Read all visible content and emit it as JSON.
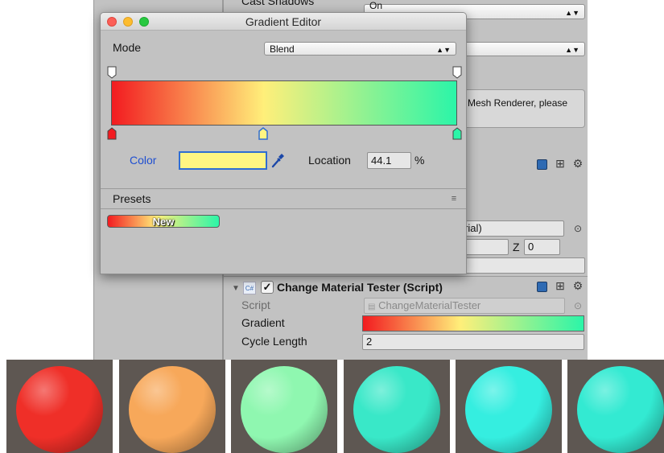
{
  "inspector": {
    "cast_shadows_label": "Cast Shadows",
    "cast_shadows_value": "On",
    "help_text": "Mesh Renderer, please",
    "material_field": "rial)",
    "z_label": "Z",
    "z_value": "0"
  },
  "component": {
    "title": "Change Material Tester (Script)",
    "script_icon_text": "C#",
    "enabled": true,
    "script_label": "Script",
    "script_value": "ChangeMaterialTester",
    "gradient_label": "Gradient",
    "cycle_length_label": "Cycle Length",
    "cycle_length_value": "2"
  },
  "gradient_editor": {
    "title": "Gradient Editor",
    "mode_label": "Mode",
    "mode_value": "Blend",
    "color_label": "Color",
    "location_label": "Location",
    "location_value": "44.1",
    "location_unit": "%",
    "presets_label": "Presets",
    "preset_name": "New",
    "selected_color": "#fff582",
    "color_keys": [
      {
        "location": 0,
        "color": "#f21b20"
      },
      {
        "location": 44.1,
        "color": "#ffef7a"
      },
      {
        "location": 100,
        "color": "#2bf5a8"
      }
    ],
    "alpha_keys": [
      {
        "location": 0,
        "alpha": 1
      },
      {
        "location": 100,
        "alpha": 1
      }
    ]
  },
  "spheres": [
    {
      "color": "#ef2f28"
    },
    {
      "color": "#f7a85a"
    },
    {
      "color": "#8ff7b0"
    },
    {
      "color": "#39e8c8"
    },
    {
      "color": "#35eee0"
    },
    {
      "color": "#33ead2"
    }
  ],
  "colors": {
    "link_blue": "#1f4fd1",
    "selection_blue": "#2f6dd2"
  }
}
